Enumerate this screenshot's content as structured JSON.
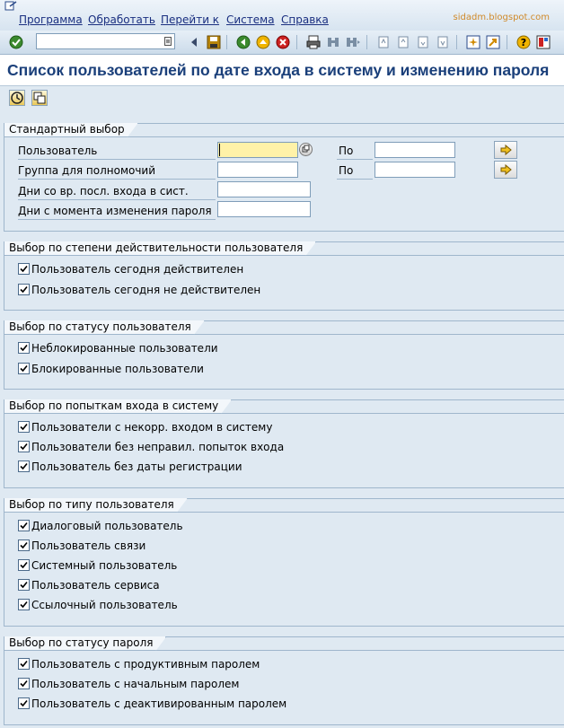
{
  "menu": {
    "items": [
      "Программа",
      "Обработать",
      "Перейти к",
      "Система",
      "Справка"
    ],
    "watermark": "sidadm.blogspot.com"
  },
  "toolbar": {
    "command_value": "",
    "icons": [
      "enter-icon",
      "command-dropdown-icon",
      "back-arrow-icon",
      "save-icon",
      "back-icon",
      "exit-icon",
      "cancel-icon",
      "print-icon",
      "find-icon",
      "find-next-icon",
      "first-page-icon",
      "prev-page-icon",
      "next-page-icon",
      "last-page-icon",
      "new-session-icon",
      "shortcut-icon",
      "help-icon",
      "layout-icon"
    ]
  },
  "title": "Список пользователей по дате входа в систему и изменению пароля",
  "app_toolbar": {
    "icons": [
      "execute-icon",
      "get-variant-icon"
    ]
  },
  "standard": {
    "title": "Стандартный выбор",
    "to_label": "По",
    "rows": [
      {
        "label": "Пользователь",
        "value": "",
        "to_value": ""
      },
      {
        "label": "Группа для полномочий",
        "value": "",
        "to_value": ""
      },
      {
        "label": "Дни со вр. посл. входа в сист.",
        "value": ""
      },
      {
        "label": "Дни с момента изменения пароля",
        "value": ""
      }
    ]
  },
  "groups": [
    {
      "title": "Выбор по степени действительности пользователя",
      "items": [
        {
          "label": "Пользователь сегодня действителен",
          "checked": true
        },
        {
          "label": "Пользователь сегодня не действителен",
          "checked": true
        }
      ]
    },
    {
      "title": "Выбор по статусу пользователя",
      "items": [
        {
          "label": "Неблокированные пользователи",
          "checked": true
        },
        {
          "label": "Блокированные пользователи",
          "checked": true
        }
      ]
    },
    {
      "title": "Выбор по попыткам входа в систему",
      "items": [
        {
          "label": "Пользователи с некорр. входом в систему",
          "checked": true
        },
        {
          "label": "Пользователи без неправил. попыток входа",
          "checked": true
        },
        {
          "label": "Пользователь без даты регистрации",
          "checked": true
        }
      ]
    },
    {
      "title": "Выбор по типу пользователя",
      "items": [
        {
          "label": "Диалоговый пользователь",
          "checked": true
        },
        {
          "label": "Пользователь связи",
          "checked": true
        },
        {
          "label": "Системный пользователь",
          "checked": true
        },
        {
          "label": "Пользователь сервиса",
          "checked": true
        },
        {
          "label": "Ссылочный пользователь",
          "checked": true
        }
      ]
    },
    {
      "title": "Выбор по статусу пароля",
      "items": [
        {
          "label": "Пользователь с продуктивным паролем",
          "checked": true
        },
        {
          "label": "Пользователь с начальным паролем",
          "checked": true
        },
        {
          "label": "Пользователь с деактивированным паролем",
          "checked": true
        }
      ]
    }
  ]
}
